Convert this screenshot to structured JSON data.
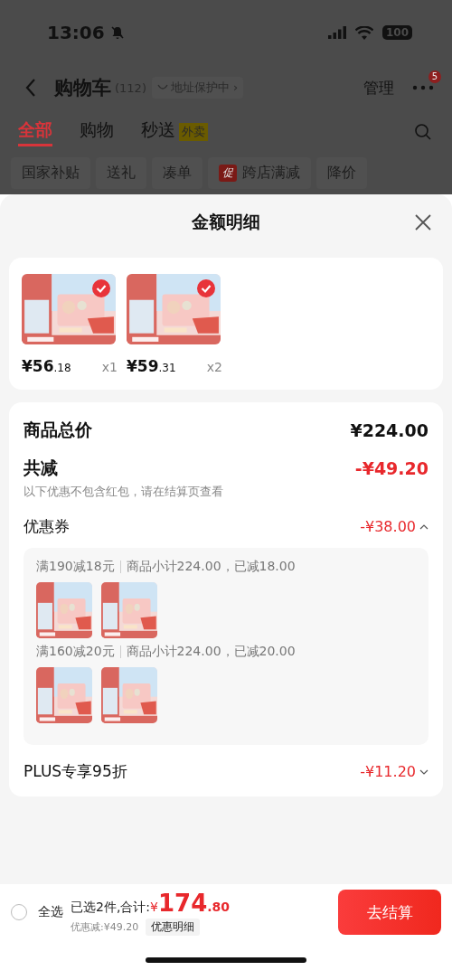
{
  "status_bar": {
    "time": "13:06",
    "battery": "100"
  },
  "header": {
    "title": "购物车",
    "count": "(112)",
    "address_protection": "地址保护中 ›",
    "manage": "管理",
    "more_badge": "5"
  },
  "tabs": [
    {
      "label": "全部",
      "selected": true
    },
    {
      "label": "购物",
      "selected": false
    },
    {
      "label": "秒送",
      "selected": false,
      "badge": "外卖"
    }
  ],
  "filters": [
    {
      "label": "国家补贴"
    },
    {
      "label": "送礼"
    },
    {
      "label": "凑单"
    },
    {
      "label": "跨店满减",
      "tag": "促"
    },
    {
      "label": "降价"
    }
  ],
  "sheet": {
    "title": "金额明细",
    "products": [
      {
        "kind": "picture",
        "checked": true,
        "price": "¥56.18",
        "quantity": "x1"
      },
      {
        "kind": "picture",
        "checked": true,
        "price": "¥59.31",
        "quantity": "x2"
      }
    ],
    "total": {
      "label": "商品总价",
      "value": "¥224.00"
    },
    "discount": {
      "label": "共减",
      "value": "-¥49.20",
      "note": "以下优惠不包含红包，请在结算页查看"
    },
    "coupons": {
      "label": "优惠券",
      "value": "-¥38.00",
      "expanded": true,
      "groups": [
        {
          "rule": "满190减18元",
          "detail": "商品小计224.00，已减18.00"
        },
        {
          "rule": "满160减20元",
          "detail": "商品小计224.00，已减20.00"
        }
      ]
    },
    "plus": {
      "label": "PLUS专享95折",
      "value": "-¥11.20",
      "expanded": false
    }
  },
  "footer": {
    "select_all": {
      "label": "全选",
      "checked": false
    },
    "summary": "已选2件,合计:",
    "total": "¥174.80",
    "saving": "优惠减:¥49.20",
    "detail_button": "优惠明细",
    "checkout": "去结算"
  }
}
